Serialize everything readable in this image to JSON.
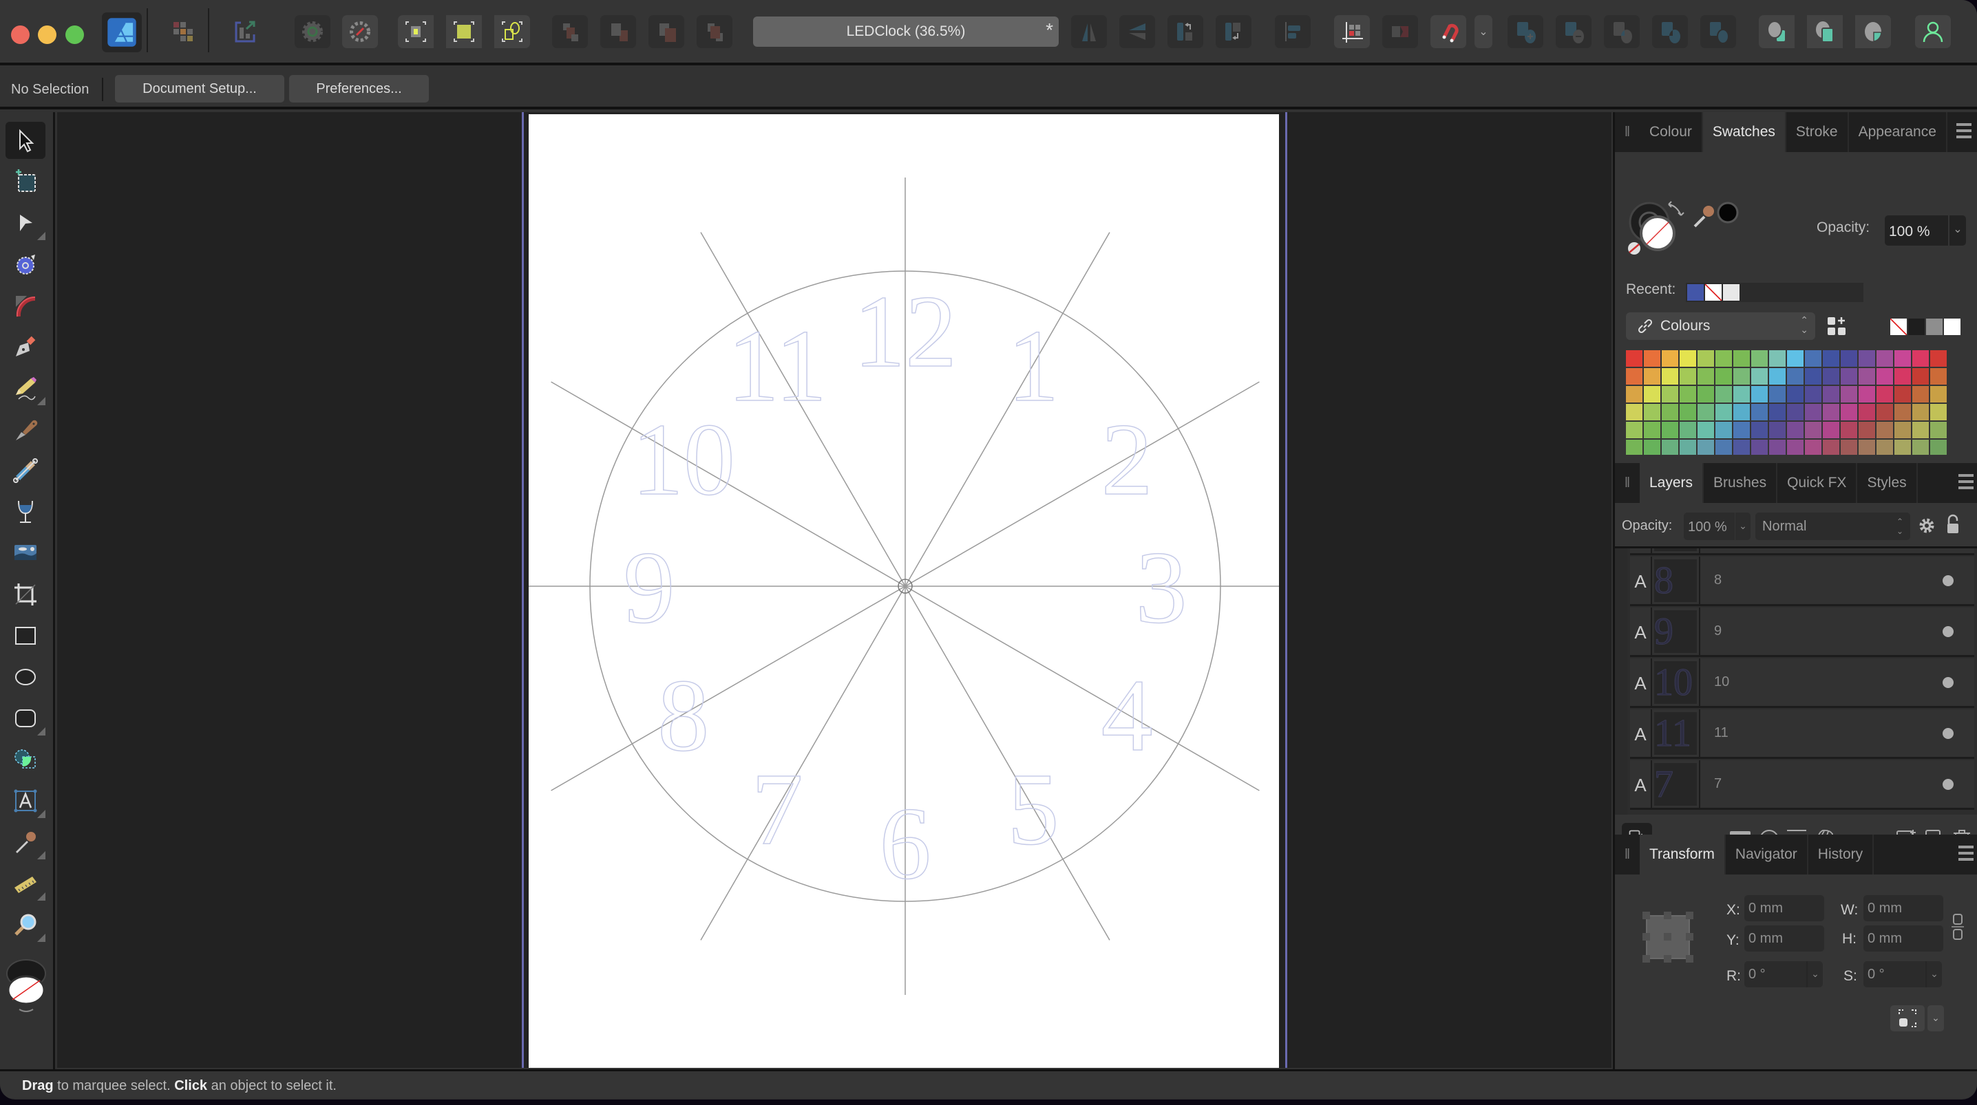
{
  "app": {
    "name": "Affinity Designer",
    "document_title": "LEDClock (36.5%)",
    "modified_marker": "*"
  },
  "toolbar": {
    "groups": [
      {
        "name": "personas",
        "items": [
          "designer-persona-icon",
          "pixel-persona-icon",
          "export-persona-icon"
        ]
      },
      {
        "name": "snapping-settings",
        "items": [
          "view-mode-gear-icon",
          "force-pixel-alignment-icon"
        ]
      },
      {
        "name": "selection-modes",
        "items": [
          "select-inside-icon",
          "select-all-grid-icon",
          "select-intersecting-icon"
        ]
      },
      {
        "name": "arrange",
        "items": [
          "move-to-back-icon",
          "move-back-one-icon",
          "move-forward-one-icon",
          "move-to-front-icon"
        ]
      },
      {
        "name": "flip-rotate",
        "items": [
          "flip-horizontal-icon",
          "flip-vertical-icon",
          "rotate-left-icon",
          "rotate-right-icon"
        ]
      },
      {
        "name": "align",
        "items": [
          "align-left-icon"
        ]
      },
      {
        "name": "snapping",
        "items": [
          "transform-origin-icon",
          "constraints-icon",
          "snapping-magnet-icon",
          "snapping-dropdown-icon"
        ]
      },
      {
        "name": "boolean",
        "items": [
          "add-icon",
          "subtract-icon",
          "intersect-icon",
          "xor-icon",
          "divide-icon"
        ]
      },
      {
        "name": "insert",
        "items": [
          "insert-behind-icon",
          "insert-top-icon",
          "insert-inside-icon"
        ]
      },
      {
        "name": "account",
        "items": [
          "user-account-icon"
        ]
      }
    ]
  },
  "contextbar": {
    "selection_label": "No Selection",
    "document_setup_label": "Document Setup...",
    "preferences_label": "Preferences..."
  },
  "tools": [
    {
      "name": "move-tool",
      "active": true
    },
    {
      "name": "artboard-tool"
    },
    {
      "name": "node-tool"
    },
    {
      "name": "point-transform-tool"
    },
    {
      "name": "corner-tool"
    },
    {
      "name": "pen-tool"
    },
    {
      "name": "pencil-tool"
    },
    {
      "name": "vector-brush-tool"
    },
    {
      "name": "vector-crop-tool"
    },
    {
      "name": "fill-tool"
    },
    {
      "name": "place-image-tool"
    },
    {
      "name": "crop-tool"
    },
    {
      "name": "rectangle-tool"
    },
    {
      "name": "ellipse-tool"
    },
    {
      "name": "rounded-rectangle-tool"
    },
    {
      "name": "shape-builder-tool"
    },
    {
      "name": "artistic-text-tool"
    },
    {
      "name": "colour-picker-tool"
    },
    {
      "name": "measure-tool"
    },
    {
      "name": "zoom-tool"
    }
  ],
  "canvas": {
    "numerals": [
      "12",
      "1",
      "2",
      "3",
      "4",
      "5",
      "6",
      "7",
      "8",
      "9",
      "10",
      "11"
    ],
    "numeral_color": "#c6cbe8",
    "guide_line_color": "#9a9a9a",
    "guide_rule_color": "#6a6ab0"
  },
  "swatches_panel": {
    "tabs": [
      "Colour",
      "Swatches",
      "Stroke",
      "Appearance"
    ],
    "active_tab": "Swatches",
    "opacity_label": "Opacity:",
    "opacity_value": "100 %",
    "recent_label": "Recent:",
    "recent_colors": [
      "#4356a8",
      "none",
      "#e8e8e8"
    ],
    "palette_name": "Colours",
    "quick_colors": [
      "none",
      "#1e1e1e",
      "#8e8e8e",
      "#ffffff"
    ],
    "palette_rows": [
      [
        "#e03c35",
        "#e8703a",
        "#ecb043",
        "#e4e34f",
        "#a9c957",
        "#86bf55",
        "#7bba55",
        "#7cbd74",
        "#7cc2b4",
        "#5fc0e6",
        "#4a72b4",
        "#4153a1",
        "#4a4b9b",
        "#724f9c",
        "#a2509a",
        "#c84796",
        "#db3963",
        "#d33b35"
      ],
      [
        "#e06e3b",
        "#e3a845",
        "#dee053",
        "#a4c957",
        "#84bd56",
        "#73b852",
        "#7aba77",
        "#7ac4b3",
        "#5ab9de",
        "#4a74b3",
        "#4253a0",
        "#4f4c98",
        "#744d9a",
        "#9b5297",
        "#c44694",
        "#d63864",
        "#c63c33",
        "#cc6b38"
      ],
      [
        "#d9a445",
        "#d9de55",
        "#a2c85a",
        "#80bc55",
        "#70b656",
        "#71b97b",
        "#70c1b0",
        "#58b4d8",
        "#4873b2",
        "#41509c",
        "#524c99",
        "#734c98",
        "#9e4f96",
        "#bf4692",
        "#cf3a64",
        "#bd3e3a",
        "#c26b3b",
        "#c9a045"
      ],
      [
        "#cfd15a",
        "#9ec75b",
        "#7db955",
        "#6db557",
        "#70b87f",
        "#6cbfa9",
        "#58aecb",
        "#4a76b4",
        "#44509b",
        "#554b95",
        "#7a4c97",
        "#9b4e95",
        "#b8458e",
        "#bf3c63",
        "#b34644",
        "#b46e45",
        "#ba9b4c",
        "#c1c157"
      ],
      [
        "#9bc55b",
        "#79b955",
        "#6ab55a",
        "#69b57f",
        "#6abfaa",
        "#5aa7bf",
        "#4c78b6",
        "#4a529b",
        "#584b93",
        "#7a4c96",
        "#99528f",
        "#b0468c",
        "#b24560",
        "#a8514f",
        "#a97352",
        "#ae9353",
        "#b2b35c",
        "#8eb05d"
      ],
      [
        "#76b556",
        "#67b25b",
        "#69b07f",
        "#66ae9e",
        "#649fae",
        "#4f7ab0",
        "#4f589f",
        "#654d96",
        "#7b4c95",
        "#934c92",
        "#a84d87",
        "#a64f63",
        "#9f5a58",
        "#a0765c",
        "#a38c5d",
        "#a7a761",
        "#8fa862",
        "#70a35e"
      ]
    ],
    "search_placeholder": ""
  },
  "layers_panel": {
    "tabs": [
      "Layers",
      "Brushes",
      "Quick FX",
      "Styles"
    ],
    "active_tab": "Layers",
    "opacity_label": "Opacity:",
    "opacity_value": "100 %",
    "blend_mode": "Normal",
    "layers": [
      {
        "type": "A",
        "name": "8",
        "thumb": "8",
        "visible": true
      },
      {
        "type": "A",
        "name": "9",
        "thumb": "9",
        "visible": true
      },
      {
        "type": "A",
        "name": "10",
        "thumb": "10",
        "visible": true
      },
      {
        "type": "A",
        "name": "11",
        "thumb": "11",
        "visible": true
      },
      {
        "type": "A",
        "name": "7",
        "thumb": "7",
        "visible": true
      }
    ]
  },
  "transform_panel": {
    "tabs": [
      "Transform",
      "Navigator",
      "History"
    ],
    "active_tab": "Transform",
    "fields": {
      "x": {
        "label": "X:",
        "value": "0 mm"
      },
      "y": {
        "label": "Y:",
        "value": "0 mm"
      },
      "w": {
        "label": "W:",
        "value": "0 mm"
      },
      "h": {
        "label": "H:",
        "value": "0 mm"
      },
      "r": {
        "label": "R:",
        "value": "0 °"
      },
      "s": {
        "label": "S:",
        "value": "0 °"
      }
    }
  },
  "statusbar": {
    "hint_bold_1": "Drag",
    "hint_text_1": " to marquee select. ",
    "hint_bold_2": "Click",
    "hint_text_2": " an object to select it."
  }
}
